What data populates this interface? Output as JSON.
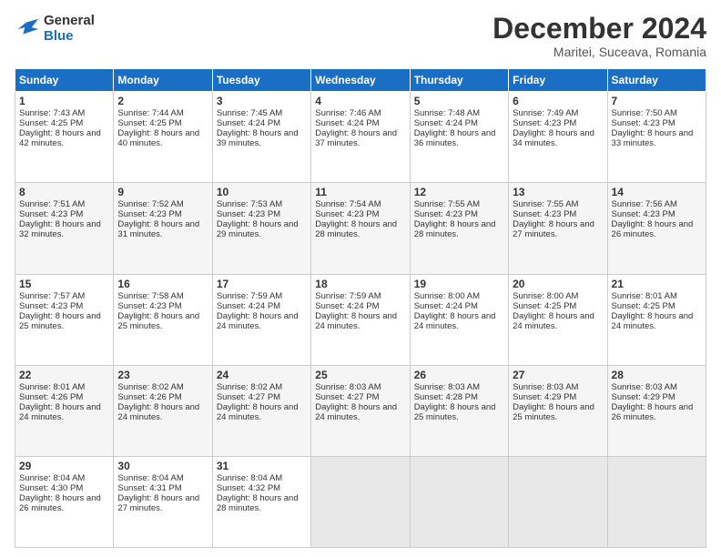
{
  "logo": {
    "line1": "General",
    "line2": "Blue"
  },
  "title": "December 2024",
  "subtitle": "Maritei, Suceava, Romania",
  "days": [
    "Sunday",
    "Monday",
    "Tuesday",
    "Wednesday",
    "Thursday",
    "Friday",
    "Saturday"
  ],
  "weeks": [
    [
      {
        "day": "1",
        "sunrise": "Sunrise: 7:43 AM",
        "sunset": "Sunset: 4:25 PM",
        "daylight": "Daylight: 8 hours and 42 minutes."
      },
      {
        "day": "2",
        "sunrise": "Sunrise: 7:44 AM",
        "sunset": "Sunset: 4:25 PM",
        "daylight": "Daylight: 8 hours and 40 minutes."
      },
      {
        "day": "3",
        "sunrise": "Sunrise: 7:45 AM",
        "sunset": "Sunset: 4:24 PM",
        "daylight": "Daylight: 8 hours and 39 minutes."
      },
      {
        "day": "4",
        "sunrise": "Sunrise: 7:46 AM",
        "sunset": "Sunset: 4:24 PM",
        "daylight": "Daylight: 8 hours and 37 minutes."
      },
      {
        "day": "5",
        "sunrise": "Sunrise: 7:48 AM",
        "sunset": "Sunset: 4:24 PM",
        "daylight": "Daylight: 8 hours and 36 minutes."
      },
      {
        "day": "6",
        "sunrise": "Sunrise: 7:49 AM",
        "sunset": "Sunset: 4:23 PM",
        "daylight": "Daylight: 8 hours and 34 minutes."
      },
      {
        "day": "7",
        "sunrise": "Sunrise: 7:50 AM",
        "sunset": "Sunset: 4:23 PM",
        "daylight": "Daylight: 8 hours and 33 minutes."
      }
    ],
    [
      {
        "day": "8",
        "sunrise": "Sunrise: 7:51 AM",
        "sunset": "Sunset: 4:23 PM",
        "daylight": "Daylight: 8 hours and 32 minutes."
      },
      {
        "day": "9",
        "sunrise": "Sunrise: 7:52 AM",
        "sunset": "Sunset: 4:23 PM",
        "daylight": "Daylight: 8 hours and 31 minutes."
      },
      {
        "day": "10",
        "sunrise": "Sunrise: 7:53 AM",
        "sunset": "Sunset: 4:23 PM",
        "daylight": "Daylight: 8 hours and 29 minutes."
      },
      {
        "day": "11",
        "sunrise": "Sunrise: 7:54 AM",
        "sunset": "Sunset: 4:23 PM",
        "daylight": "Daylight: 8 hours and 28 minutes."
      },
      {
        "day": "12",
        "sunrise": "Sunrise: 7:55 AM",
        "sunset": "Sunset: 4:23 PM",
        "daylight": "Daylight: 8 hours and 28 minutes."
      },
      {
        "day": "13",
        "sunrise": "Sunrise: 7:55 AM",
        "sunset": "Sunset: 4:23 PM",
        "daylight": "Daylight: 8 hours and 27 minutes."
      },
      {
        "day": "14",
        "sunrise": "Sunrise: 7:56 AM",
        "sunset": "Sunset: 4:23 PM",
        "daylight": "Daylight: 8 hours and 26 minutes."
      }
    ],
    [
      {
        "day": "15",
        "sunrise": "Sunrise: 7:57 AM",
        "sunset": "Sunset: 4:23 PM",
        "daylight": "Daylight: 8 hours and 25 minutes."
      },
      {
        "day": "16",
        "sunrise": "Sunrise: 7:58 AM",
        "sunset": "Sunset: 4:23 PM",
        "daylight": "Daylight: 8 hours and 25 minutes."
      },
      {
        "day": "17",
        "sunrise": "Sunrise: 7:59 AM",
        "sunset": "Sunset: 4:24 PM",
        "daylight": "Daylight: 8 hours and 24 minutes."
      },
      {
        "day": "18",
        "sunrise": "Sunrise: 7:59 AM",
        "sunset": "Sunset: 4:24 PM",
        "daylight": "Daylight: 8 hours and 24 minutes."
      },
      {
        "day": "19",
        "sunrise": "Sunrise: 8:00 AM",
        "sunset": "Sunset: 4:24 PM",
        "daylight": "Daylight: 8 hours and 24 minutes."
      },
      {
        "day": "20",
        "sunrise": "Sunrise: 8:00 AM",
        "sunset": "Sunset: 4:25 PM",
        "daylight": "Daylight: 8 hours and 24 minutes."
      },
      {
        "day": "21",
        "sunrise": "Sunrise: 8:01 AM",
        "sunset": "Sunset: 4:25 PM",
        "daylight": "Daylight: 8 hours and 24 minutes."
      }
    ],
    [
      {
        "day": "22",
        "sunrise": "Sunrise: 8:01 AM",
        "sunset": "Sunset: 4:26 PM",
        "daylight": "Daylight: 8 hours and 24 minutes."
      },
      {
        "day": "23",
        "sunrise": "Sunrise: 8:02 AM",
        "sunset": "Sunset: 4:26 PM",
        "daylight": "Daylight: 8 hours and 24 minutes."
      },
      {
        "day": "24",
        "sunrise": "Sunrise: 8:02 AM",
        "sunset": "Sunset: 4:27 PM",
        "daylight": "Daylight: 8 hours and 24 minutes."
      },
      {
        "day": "25",
        "sunrise": "Sunrise: 8:03 AM",
        "sunset": "Sunset: 4:27 PM",
        "daylight": "Daylight: 8 hours and 24 minutes."
      },
      {
        "day": "26",
        "sunrise": "Sunrise: 8:03 AM",
        "sunset": "Sunset: 4:28 PM",
        "daylight": "Daylight: 8 hours and 25 minutes."
      },
      {
        "day": "27",
        "sunrise": "Sunrise: 8:03 AM",
        "sunset": "Sunset: 4:29 PM",
        "daylight": "Daylight: 8 hours and 25 minutes."
      },
      {
        "day": "28",
        "sunrise": "Sunrise: 8:03 AM",
        "sunset": "Sunset: 4:29 PM",
        "daylight": "Daylight: 8 hours and 26 minutes."
      }
    ],
    [
      {
        "day": "29",
        "sunrise": "Sunrise: 8:04 AM",
        "sunset": "Sunset: 4:30 PM",
        "daylight": "Daylight: 8 hours and 26 minutes."
      },
      {
        "day": "30",
        "sunrise": "Sunrise: 8:04 AM",
        "sunset": "Sunset: 4:31 PM",
        "daylight": "Daylight: 8 hours and 27 minutes."
      },
      {
        "day": "31",
        "sunrise": "Sunrise: 8:04 AM",
        "sunset": "Sunset: 4:32 PM",
        "daylight": "Daylight: 8 hours and 28 minutes."
      },
      null,
      null,
      null,
      null
    ]
  ]
}
